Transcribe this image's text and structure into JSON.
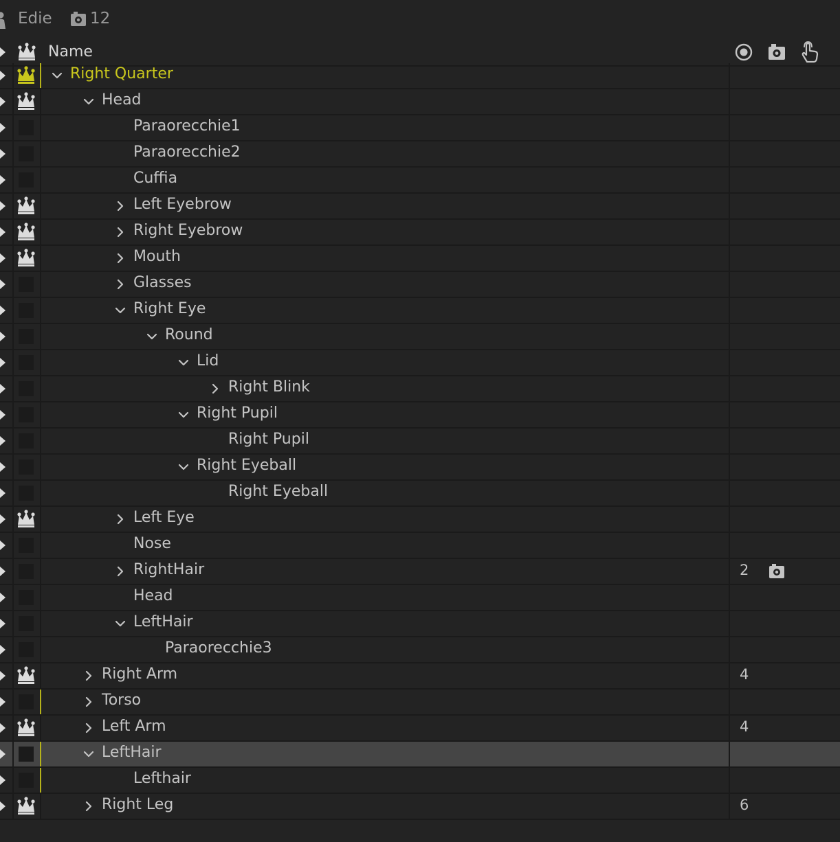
{
  "topbar": {
    "puppet_name": "Edie",
    "camera_count": "12"
  },
  "header": {
    "name_label": "Name"
  },
  "colors": {
    "root_label": "#c9c71d",
    "crown_root": "#c9c71d",
    "crown_default": "#dcdcdc",
    "selected_row": "#454545",
    "accent_bar": "#b5b21a"
  },
  "icons": {
    "person": "person-icon",
    "record": "record-icon",
    "camera": "camera-icon",
    "hand": "hand-icon",
    "crown": "crown-icon",
    "chevron": "chevron-icon"
  },
  "rows": [
    {
      "label": "Right Quarter",
      "depth": 0,
      "expander": "down",
      "tag": "crown",
      "root": true,
      "yellow": true
    },
    {
      "label": "Head",
      "depth": 1,
      "expander": "down",
      "tag": "crown"
    },
    {
      "label": "Paraorecchie1",
      "depth": 2,
      "expander": "none",
      "tag": "box"
    },
    {
      "label": "Paraorecchie2",
      "depth": 2,
      "expander": "none",
      "tag": "box"
    },
    {
      "label": "Cuffia",
      "depth": 2,
      "expander": "none",
      "tag": "box"
    },
    {
      "label": "Left Eyebrow",
      "depth": 2,
      "expander": "right",
      "tag": "crown"
    },
    {
      "label": "Right Eyebrow",
      "depth": 2,
      "expander": "right",
      "tag": "crown"
    },
    {
      "label": "Mouth",
      "depth": 2,
      "expander": "right",
      "tag": "crown"
    },
    {
      "label": "Glasses",
      "depth": 2,
      "expander": "right",
      "tag": "box"
    },
    {
      "label": "Right Eye",
      "depth": 2,
      "expander": "down",
      "tag": "box"
    },
    {
      "label": "Round",
      "depth": 3,
      "expander": "down",
      "tag": "box"
    },
    {
      "label": "Lid",
      "depth": 4,
      "expander": "down",
      "tag": "box"
    },
    {
      "label": "Right Blink",
      "depth": 5,
      "expander": "right",
      "tag": "box"
    },
    {
      "label": "Right Pupil",
      "depth": 4,
      "expander": "down",
      "tag": "box"
    },
    {
      "label": "Right Pupil",
      "depth": 5,
      "expander": "none",
      "tag": "box"
    },
    {
      "label": "Right Eyeball",
      "depth": 4,
      "expander": "down",
      "tag": "box"
    },
    {
      "label": "Right Eyeball",
      "depth": 5,
      "expander": "none",
      "tag": "box"
    },
    {
      "label": "Left Eye",
      "depth": 2,
      "expander": "right",
      "tag": "crown"
    },
    {
      "label": "Nose",
      "depth": 2,
      "expander": "none",
      "tag": "box"
    },
    {
      "label": "RightHair",
      "depth": 2,
      "expander": "right",
      "tag": "box",
      "count": "2",
      "camera": true
    },
    {
      "label": "Head",
      "depth": 2,
      "expander": "none",
      "tag": "box"
    },
    {
      "label": "LeftHair",
      "depth": 2,
      "expander": "down",
      "tag": "box"
    },
    {
      "label": "Paraorecchie3",
      "depth": 3,
      "expander": "none",
      "tag": "box"
    },
    {
      "label": "Right Arm",
      "depth": 1,
      "expander": "right",
      "tag": "crown",
      "count": "4"
    },
    {
      "label": "Torso",
      "depth": 1,
      "expander": "right",
      "tag": "box",
      "yellow": true
    },
    {
      "label": "Left Arm",
      "depth": 1,
      "expander": "right",
      "tag": "crown",
      "count": "4"
    },
    {
      "label": "LeftHair",
      "depth": 1,
      "expander": "down",
      "tag": "box",
      "yellow": true,
      "selected": true
    },
    {
      "label": "Lefthair",
      "depth": 2,
      "expander": "none",
      "tag": "box",
      "yellow": true
    },
    {
      "label": "Right Leg",
      "depth": 1,
      "expander": "right",
      "tag": "crown",
      "count": "6"
    }
  ]
}
